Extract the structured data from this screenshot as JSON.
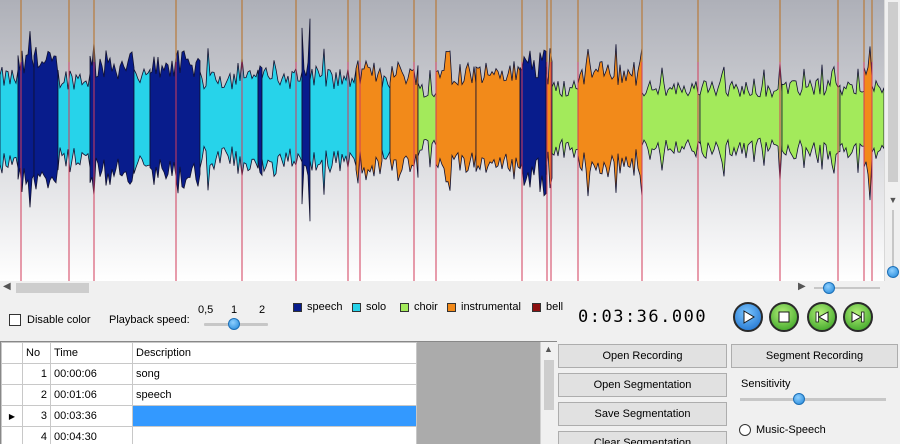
{
  "legend": [
    {
      "label": "speech",
      "color": "#081c8c"
    },
    {
      "label": "solo",
      "color": "#27d3ea"
    },
    {
      "label": "choir",
      "color": "#a3ea5b"
    },
    {
      "label": "instrumental",
      "color": "#f28a1a"
    },
    {
      "label": "bell",
      "color": "#8c1010"
    }
  ],
  "disable_color_label": "Disable color",
  "playback": {
    "label": "Playback speed:",
    "ticks": [
      "0,5",
      "1",
      "2"
    ],
    "value": 1
  },
  "timer": "0:03:36.000",
  "transport_buttons": [
    "play",
    "stop",
    "skip-back",
    "skip-forward"
  ],
  "grid": {
    "headers": [
      "No",
      "Time",
      "Description"
    ],
    "rows": [
      {
        "no": "1",
        "time": "00:00:06",
        "desc": "song",
        "selected": false
      },
      {
        "no": "2",
        "time": "00:01:06",
        "desc": "speech",
        "selected": false
      },
      {
        "no": "3",
        "time": "00:03:36",
        "desc": "",
        "selected": true
      },
      {
        "no": "4",
        "time": "00:04:30",
        "desc": "",
        "selected": false
      }
    ]
  },
  "buttons": {
    "open_recording": "Open Recording",
    "segment_recording": "Segment Recording",
    "open_segmentation": "Open Segmentation",
    "save_segmentation": "Save Segmentation",
    "clear_segmentation": "Clear Segmentation"
  },
  "sensitivity_label": "Sensitivity",
  "sensitivity_value": 0.42,
  "music_speech_label": "Music-Speech",
  "waveform_colors": {
    "bg_top": "#aeb0b8",
    "bg_bottom": "#ffffff",
    "marker_line": "#d23b5a",
    "marker_top": "#b87a3a",
    "outline": "#101030"
  }
}
